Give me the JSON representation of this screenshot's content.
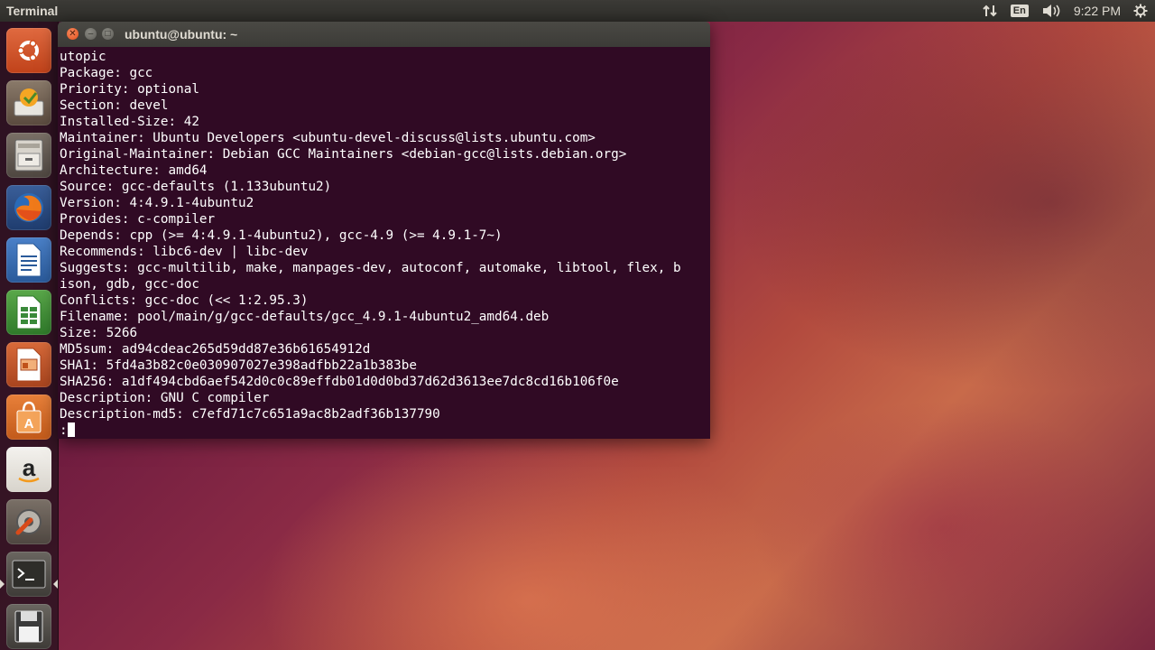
{
  "top_panel": {
    "app_title": "Terminal",
    "keyboard_layout": "En",
    "clock": "9:22 PM"
  },
  "launcher": {
    "items": [
      {
        "name": "dash-home",
        "icon": "ubuntu-logo-icon"
      },
      {
        "name": "software-updater",
        "icon": "software-updater-icon"
      },
      {
        "name": "files",
        "icon": "file-cabinet-icon"
      },
      {
        "name": "firefox",
        "icon": "firefox-icon"
      },
      {
        "name": "libreoffice-writer",
        "icon": "writer-document-icon"
      },
      {
        "name": "libreoffice-calc",
        "icon": "calc-spreadsheet-icon"
      },
      {
        "name": "libreoffice-impress",
        "icon": "impress-presentation-icon"
      },
      {
        "name": "ubuntu-software-center",
        "icon": "shopping-bag-icon"
      },
      {
        "name": "amazon",
        "icon": "amazon-icon"
      },
      {
        "name": "system-settings",
        "icon": "settings-wrench-icon"
      },
      {
        "name": "terminal",
        "icon": "terminal-icon",
        "active": true
      },
      {
        "name": "disk",
        "icon": "floppy-disk-icon"
      }
    ]
  },
  "terminal": {
    "window_title": "ubuntu@ubuntu: ~",
    "lines": [
      "utopic",
      "Package: gcc",
      "Priority: optional",
      "Section: devel",
      "Installed-Size: 42",
      "Maintainer: Ubuntu Developers <ubuntu-devel-discuss@lists.ubuntu.com>",
      "Original-Maintainer: Debian GCC Maintainers <debian-gcc@lists.debian.org>",
      "Architecture: amd64",
      "Source: gcc-defaults (1.133ubuntu2)",
      "Version: 4:4.9.1-4ubuntu2",
      "Provides: c-compiler",
      "Depends: cpp (>= 4:4.9.1-4ubuntu2), gcc-4.9 (>= 4.9.1-7~)",
      "Recommends: libc6-dev | libc-dev",
      "Suggests: gcc-multilib, make, manpages-dev, autoconf, automake, libtool, flex, b",
      "ison, gdb, gcc-doc",
      "Conflicts: gcc-doc (<< 1:2.95.3)",
      "Filename: pool/main/g/gcc-defaults/gcc_4.9.1-4ubuntu2_amd64.deb",
      "Size: 5266",
      "MD5sum: ad94cdeac265d59dd87e36b61654912d",
      "SHA1: 5fd4a3b82c0e030907027e398adfbb22a1b383be",
      "SHA256: a1df494cbd6aef542d0c0c89effdb01d0d0bd37d62d3613ee7dc8cd16b106f0e",
      "Description: GNU C compiler",
      "Description-md5: c7efd71c7c651a9ac8b2adf36b137790"
    ],
    "prompt": ":"
  },
  "colors": {
    "terminal_bg": "#300a24",
    "panel_bg": "#3c3b37",
    "close_button": "#e2501c"
  }
}
